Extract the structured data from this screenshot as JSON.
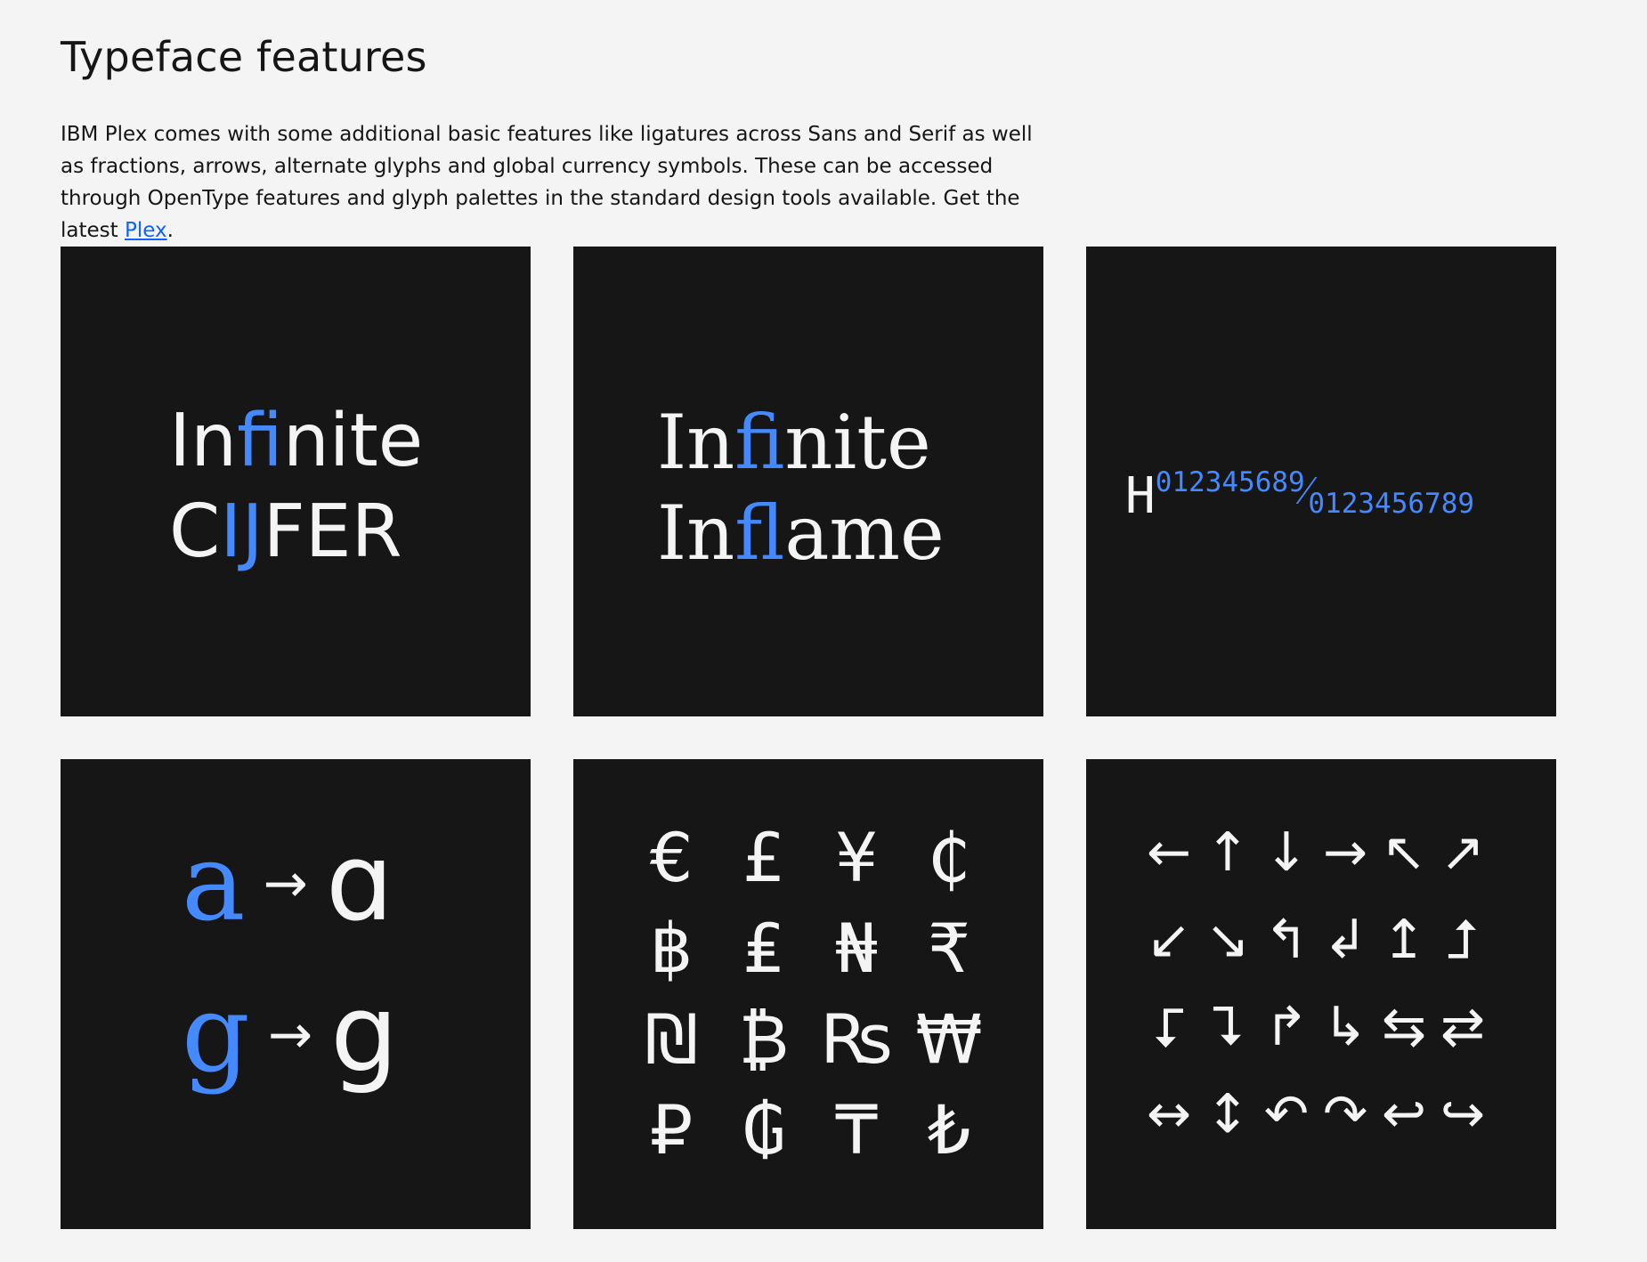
{
  "header": {
    "title": "Typeface features"
  },
  "intro": {
    "text_before_link": "IBM Plex comes with some additional basic features like ligatures across Sans and Serif as well as fractions, arrows, alternate glyphs and global currency symbols. These can be accessed through OpenType features and glyph palettes in the standard design tools available. Get the latest ",
    "link_text": "Plex",
    "text_after_link": "."
  },
  "colors": {
    "background": "#f4f4f4",
    "tile": "#161616",
    "text_light": "#f4f4f4",
    "accent_blue": "#4589ff",
    "link_blue": "#0f62fe"
  },
  "tiles": {
    "sans_ligatures": {
      "line1": {
        "pre": "In",
        "lig": "fi",
        "post": "nite"
      },
      "line2": {
        "pre": "C",
        "lig": "IJ",
        "post": "FER"
      }
    },
    "serif_ligatures": {
      "line1": {
        "pre": "In",
        "lig": "fi",
        "post": "nite"
      },
      "line2": {
        "pre": "In",
        "lig": "fl",
        "post": "ame"
      }
    },
    "fraction": {
      "base": "H",
      "numerator": "012345689",
      "slash": "⁄",
      "denominator": "0123456789"
    },
    "alternates": {
      "rows": [
        {
          "from": "a",
          "arrow": "→",
          "to": "ɑ"
        },
        {
          "from": "g",
          "arrow": "→",
          "to": "g"
        }
      ]
    },
    "currency": {
      "symbols": [
        "€",
        "£",
        "¥",
        "₵",
        "฿",
        "₤",
        "₦",
        "₹",
        "₪",
        "₿",
        "₨",
        "₩",
        "₽",
        "₲",
        "₸",
        "₺"
      ]
    },
    "arrows": {
      "symbols": [
        "←",
        "↑",
        "↓",
        "→",
        "↖",
        "↗",
        "↙",
        "↘",
        "↰",
        "↲",
        "↥",
        "⮥",
        "⮦",
        "⮧",
        "↱",
        "↳",
        "⇆",
        "⇄",
        "↔",
        "↕",
        "↶",
        "↷",
        "↩",
        "↪"
      ]
    }
  }
}
